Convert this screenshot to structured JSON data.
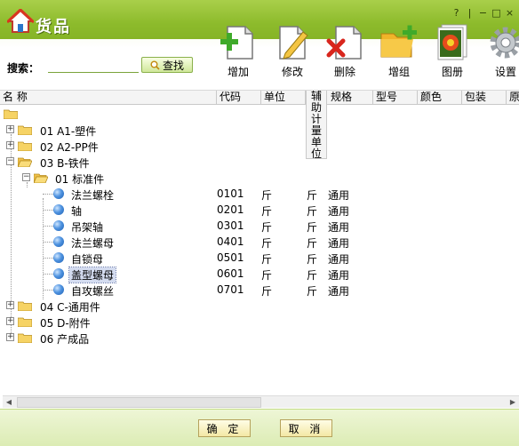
{
  "window": {
    "title": "货品",
    "controls": [
      "?",
      "|",
      "−",
      "□",
      "×"
    ]
  },
  "toolbar": [
    {
      "label": "增加",
      "icon": "add-document-icon"
    },
    {
      "label": "修改",
      "icon": "edit-document-icon"
    },
    {
      "label": "删除",
      "icon": "delete-document-icon"
    },
    {
      "label": "增组",
      "icon": "add-folder-icon"
    },
    {
      "label": "图册",
      "icon": "photo-album-icon"
    },
    {
      "label": "设置",
      "icon": "gear-icon"
    }
  ],
  "search": {
    "label": "搜索：",
    "value": "",
    "button_label": "查找"
  },
  "columns": {
    "name": "名 称",
    "code": "代码",
    "unit": "单位",
    "aux_unit": "辅助计量单位",
    "spec": "规格",
    "model": "型号",
    "color": "颜色",
    "package": "包装",
    "orig": "原"
  },
  "tree": {
    "groups": [
      {
        "label": "01 A1-塑件",
        "expanded": false
      },
      {
        "label": "02 A2-PP件",
        "expanded": false
      },
      {
        "label": "03 B-铁件",
        "expanded": true
      },
      {
        "label": "04 C-通用件",
        "expanded": false
      },
      {
        "label": "05 D-附件",
        "expanded": false
      },
      {
        "label": "06 产成品",
        "expanded": false
      }
    ],
    "subgroup": {
      "label": "01 标准件",
      "expanded": true
    },
    "items": [
      {
        "name": "法兰螺栓",
        "code": "0101",
        "unit": "斤",
        "aux_unit": "斤",
        "spec": "通用"
      },
      {
        "name": "轴",
        "code": "0201",
        "unit": "斤",
        "aux_unit": "斤",
        "spec": "通用"
      },
      {
        "name": "吊架轴",
        "code": "0301",
        "unit": "斤",
        "aux_unit": "斤",
        "spec": "通用"
      },
      {
        "name": "法兰螺母",
        "code": "0401",
        "unit": "斤",
        "aux_unit": "斤",
        "spec": "通用"
      },
      {
        "name": "自锁母",
        "code": "0501",
        "unit": "斤",
        "aux_unit": "斤",
        "spec": "通用"
      },
      {
        "name": "盖型螺母",
        "code": "0601",
        "unit": "斤",
        "aux_unit": "斤",
        "spec": "通用"
      },
      {
        "name": "自攻螺丝",
        "code": "0701",
        "unit": "斤",
        "aux_unit": "斤",
        "spec": "通用"
      }
    ]
  },
  "footer": {
    "ok_label": "确 定",
    "cancel_label": "取 消"
  }
}
